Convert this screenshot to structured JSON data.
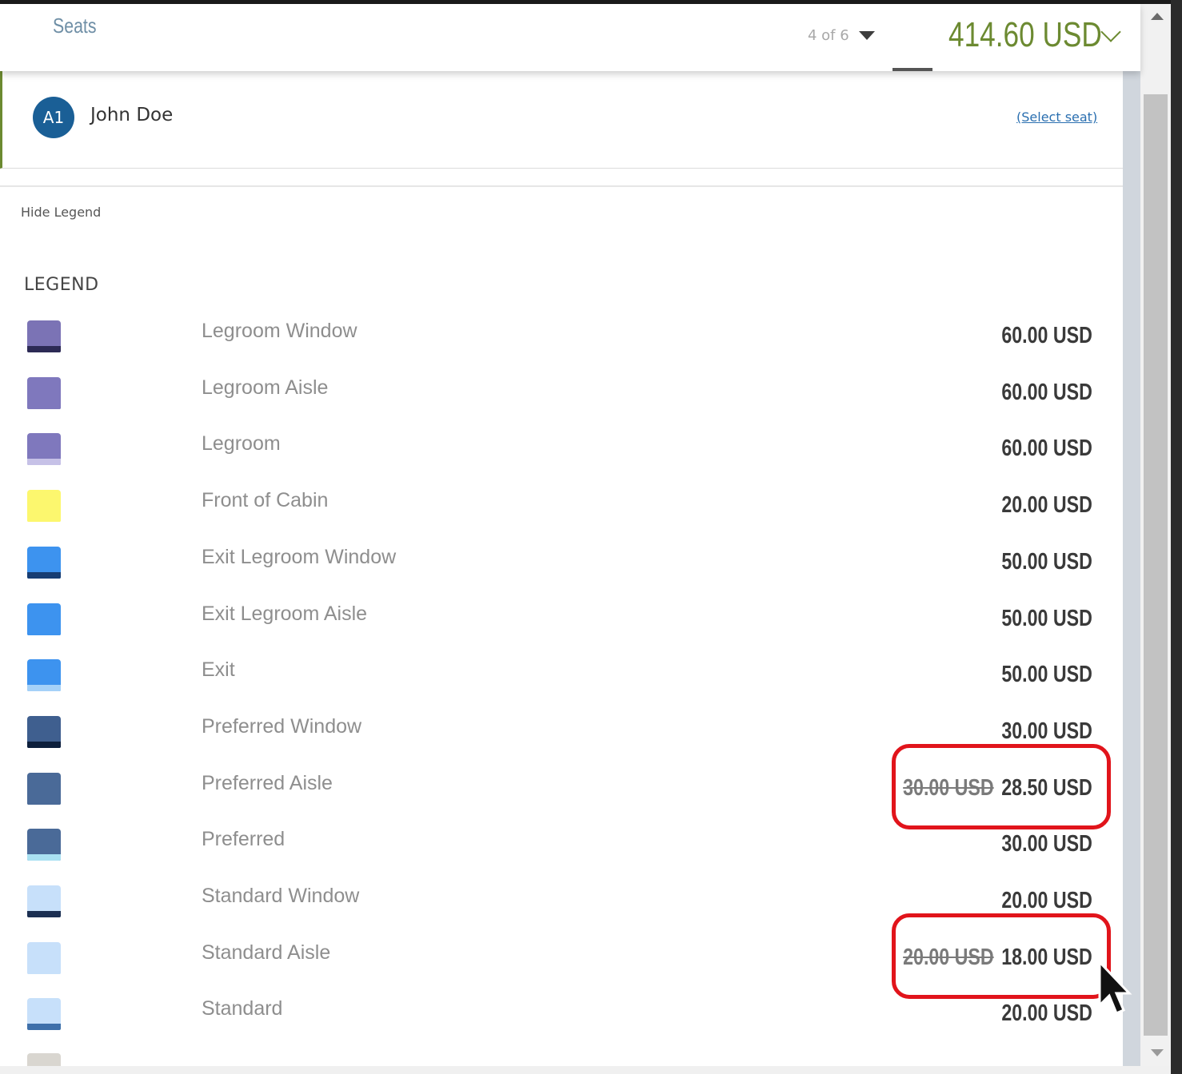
{
  "header": {
    "title": "Seats",
    "passenger_count": "4 of 6",
    "total": "414.60 USD"
  },
  "passenger": {
    "badge": "A1",
    "name": "John Doe",
    "select_link": "(Select seat)"
  },
  "legend": {
    "toggle_label": "Hide Legend",
    "title": "LEGEND",
    "items": [
      {
        "label": "Legroom Window",
        "price": "60.00 USD",
        "old_price": "",
        "color": "#7b73b5",
        "stripe": "#2c2a55"
      },
      {
        "label": "Legroom Aisle",
        "price": "60.00 USD",
        "old_price": "",
        "color": "#7f78bd",
        "stripe": "#7f78bd"
      },
      {
        "label": "Legroom",
        "price": "60.00 USD",
        "old_price": "",
        "color": "#7f78bd",
        "stripe": "#c6c1e7"
      },
      {
        "label": "Front of Cabin",
        "price": "20.00 USD",
        "old_price": "",
        "color": "#fcf76e",
        "stripe": "#fcf76e"
      },
      {
        "label": "Exit Legroom Window",
        "price": "50.00 USD",
        "old_price": "",
        "color": "#3d93ef",
        "stripe": "#173d73"
      },
      {
        "label": "Exit Legroom Aisle",
        "price": "50.00 USD",
        "old_price": "",
        "color": "#3d93ef",
        "stripe": "#3d93ef"
      },
      {
        "label": "Exit",
        "price": "50.00 USD",
        "old_price": "",
        "color": "#3d93ef",
        "stripe": "#a5d1f8"
      },
      {
        "label": "Preferred Window",
        "price": "30.00 USD",
        "old_price": "",
        "color": "#3f5f8f",
        "stripe": "#0d1f3c"
      },
      {
        "label": "Preferred Aisle",
        "price": "28.50 USD",
        "old_price": "30.00 USD",
        "color": "#4a6a98",
        "stripe": "#4a6a98"
      },
      {
        "label": "Preferred",
        "price": "30.00 USD",
        "old_price": "",
        "color": "#4a6a98",
        "stripe": "#a9e1f2"
      },
      {
        "label": "Standard Window",
        "price": "20.00 USD",
        "old_price": "",
        "color": "#c7e0fa",
        "stripe": "#1b2f52"
      },
      {
        "label": "Standard Aisle",
        "price": "18.00 USD",
        "old_price": "20.00 USD",
        "color": "#c7e0fa",
        "stripe": "#c7e0fa"
      },
      {
        "label": "Standard",
        "price": "20.00 USD",
        "old_price": "",
        "color": "#c7e0fa",
        "stripe": "#3f70aa"
      }
    ]
  },
  "colors": {
    "accent_green": "#6c8a31",
    "highlight_red": "#e1141b",
    "link_blue": "#2a6fb0"
  }
}
